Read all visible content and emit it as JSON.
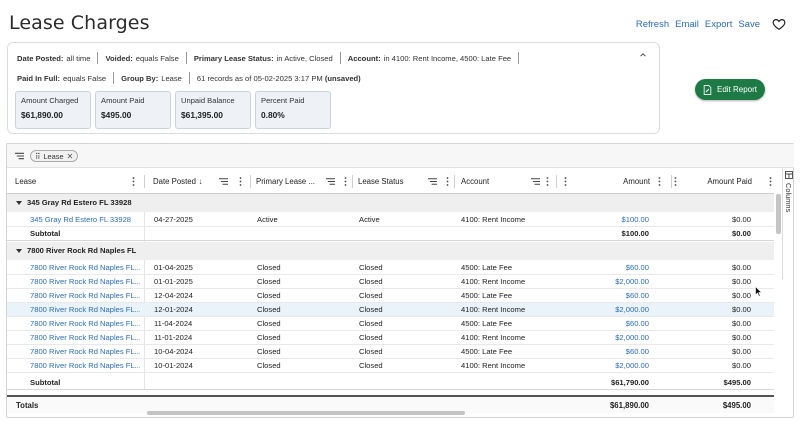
{
  "page": {
    "title": "Lease Charges"
  },
  "top_actions": {
    "refresh": "Refresh",
    "email": "Email",
    "export": "Export",
    "save": "Save"
  },
  "filters": {
    "row1": [
      {
        "key": "Date Posted:",
        "value": "all time"
      },
      {
        "key": "Voided:",
        "value": "equals False"
      },
      {
        "key": "Primary Lease Status:",
        "value": "in Active, Closed"
      },
      {
        "key": "Account:",
        "value": "in 4100: Rent Income, 4500: Late Fee"
      }
    ],
    "row2": [
      {
        "key": "Paid In Full:",
        "value": "equals False"
      },
      {
        "key": "Group By:",
        "value": "Lease"
      }
    ],
    "record_info": "61 records as of 05-02-2025 3:17 PM",
    "unsaved": "(unsaved)"
  },
  "summary": [
    {
      "label": "Amount Charged",
      "value": "$61,890.00"
    },
    {
      "label": "Amount Paid",
      "value": "$495.00"
    },
    {
      "label": "Unpaid Balance",
      "value": "$61,395.00"
    },
    {
      "label": "Percent Paid",
      "value": "0.80%"
    }
  ],
  "edit_report": {
    "label": "Edit Report"
  },
  "grid": {
    "group_pill": "Lease",
    "columns": [
      "Lease",
      "Date Posted",
      "Primary Lease ...",
      "Lease Status",
      "Account",
      "Amount",
      "Amount Paid"
    ],
    "side_panel_label": "Columns",
    "groups": [
      {
        "name": "345 Gray Rd Estero FL 33928",
        "rows": [
          {
            "lease": "345 Gray Rd Estero FL 33928",
            "date": "04-27-2025",
            "primary": "Active",
            "status": "Active",
            "account": "4100: Rent Income",
            "amount": "$100.00",
            "paid": "$0.00"
          }
        ],
        "subtotal_label": "Subtotal",
        "subtotal_amount": "$100.00",
        "subtotal_paid": "$0.00"
      },
      {
        "name": "7800 River Rock Rd Naples FL",
        "rows": [
          {
            "lease": "7800 River Rock Rd Naples FL...",
            "date": "01-04-2025",
            "primary": "Closed",
            "status": "Closed",
            "account": "4500: Late Fee",
            "amount": "$60.00",
            "paid": "$0.00"
          },
          {
            "lease": "7800 River Rock Rd Naples FL...",
            "date": "01-01-2025",
            "primary": "Closed",
            "status": "Closed",
            "account": "4100: Rent Income",
            "amount": "$2,000.00",
            "paid": "$0.00"
          },
          {
            "lease": "7800 River Rock Rd Naples FL...",
            "date": "12-04-2024",
            "primary": "Closed",
            "status": "Closed",
            "account": "4500: Late Fee",
            "amount": "$60.00",
            "paid": "$0.00"
          },
          {
            "lease": "7800 River Rock Rd Naples FL...",
            "date": "12-01-2024",
            "primary": "Closed",
            "status": "Closed",
            "account": "4100: Rent Income",
            "amount": "$2,000.00",
            "paid": "$0.00"
          },
          {
            "lease": "7800 River Rock Rd Naples FL...",
            "date": "11-04-2024",
            "primary": "Closed",
            "status": "Closed",
            "account": "4500: Late Fee",
            "amount": "$60.00",
            "paid": "$0.00"
          },
          {
            "lease": "7800 River Rock Rd Naples FL...",
            "date": "11-01-2024",
            "primary": "Closed",
            "status": "Closed",
            "account": "4100: Rent Income",
            "amount": "$2,000.00",
            "paid": "$0.00"
          },
          {
            "lease": "7800 River Rock Rd Naples FL...",
            "date": "10-04-2024",
            "primary": "Closed",
            "status": "Closed",
            "account": "4500: Late Fee",
            "amount": "$60.00",
            "paid": "$0.00"
          },
          {
            "lease": "7800 River Rock Rd Naples FL...",
            "date": "10-01-2024",
            "primary": "Closed",
            "status": "Closed",
            "account": "4100: Rent Income",
            "amount": "$2,000.00",
            "paid": "$0.00"
          }
        ],
        "subtotal_label": "Subtotal",
        "subtotal_amount": "$61,790.00",
        "subtotal_paid": "$495.00"
      }
    ],
    "totals": {
      "label": "Totals",
      "amount": "$61,890.00",
      "paid": "$495.00"
    }
  },
  "colors": {
    "accent": "#2a6db5",
    "edit_button": "#1e7a45",
    "highlight_row": "#eaf3fa",
    "summary_card": "#eef2f6"
  }
}
